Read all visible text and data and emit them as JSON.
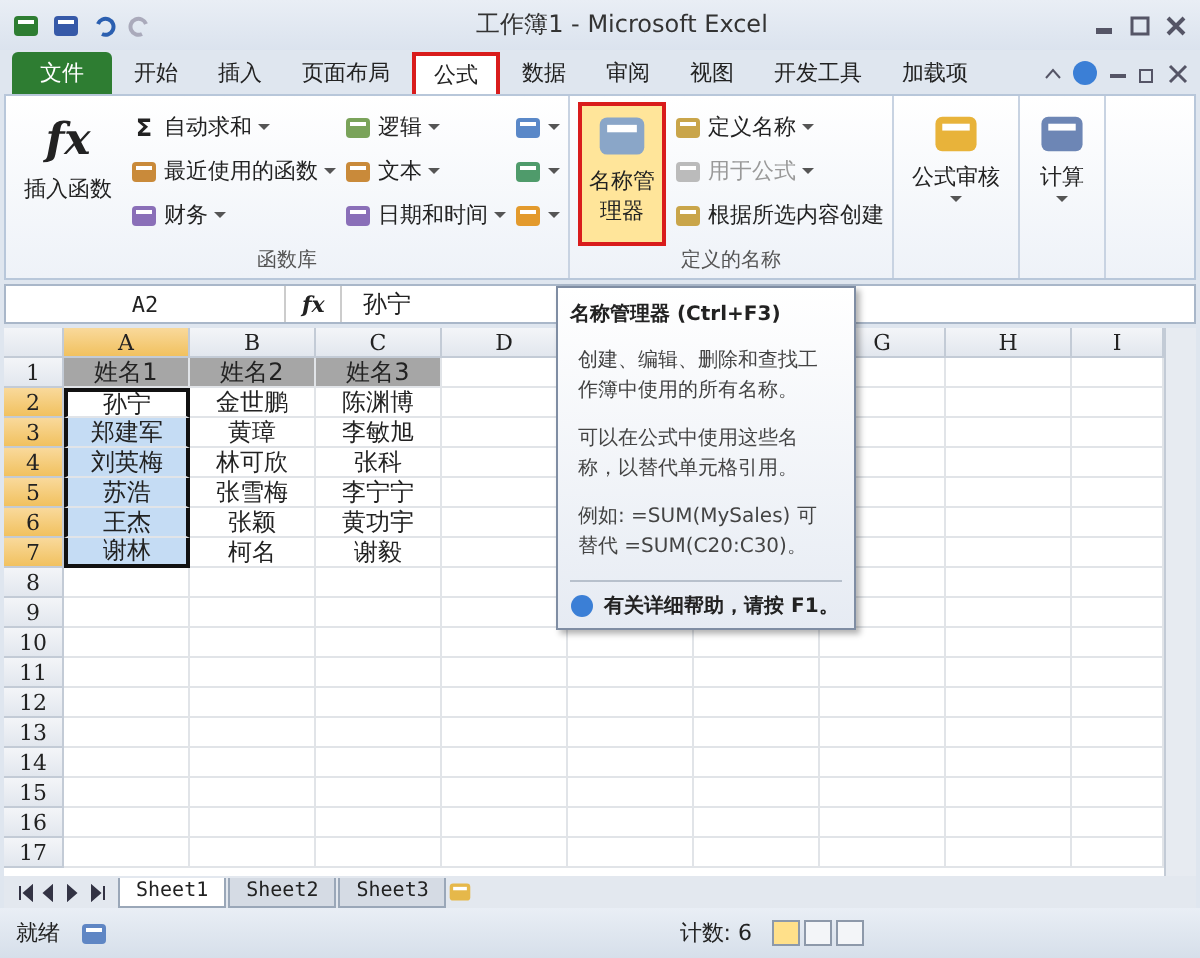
{
  "window": {
    "title": "工作簿1 - Microsoft Excel"
  },
  "tabs": [
    {
      "label": "文件",
      "kind": "file",
      "selected": false
    },
    {
      "label": "开始",
      "kind": "tab",
      "selected": false
    },
    {
      "label": "插入",
      "kind": "tab",
      "selected": false
    },
    {
      "label": "页面布局",
      "kind": "tab",
      "selected": false
    },
    {
      "label": "公式",
      "kind": "tab",
      "selected": true
    },
    {
      "label": "数据",
      "kind": "tab",
      "selected": false
    },
    {
      "label": "审阅",
      "kind": "tab",
      "selected": false
    },
    {
      "label": "视图",
      "kind": "tab",
      "selected": false
    },
    {
      "label": "开发工具",
      "kind": "tab",
      "selected": false
    },
    {
      "label": "加载项",
      "kind": "tab",
      "selected": false
    }
  ],
  "ribbon": {
    "function_library": {
      "label": "函数库",
      "insert_function": {
        "symbol": "fx",
        "label": "插入函数"
      },
      "columns": [
        [
          {
            "label": "自动求和",
            "symbol": "Σ"
          },
          {
            "label": "最近使用的函数"
          },
          {
            "label": "财务"
          }
        ],
        [
          {
            "label": "逻辑"
          },
          {
            "label": "文本"
          },
          {
            "label": "日期和时间"
          }
        ]
      ]
    },
    "defined_names": {
      "label": "定义的名称",
      "name_manager": {
        "label": "名称管理器",
        "highlighted": true
      },
      "items": [
        {
          "label": "定义名称",
          "dropdown": true,
          "disabled": false
        },
        {
          "label": "用于公式",
          "dropdown": true,
          "disabled": true
        },
        {
          "label": "根据所选内容创建",
          "dropdown": false,
          "disabled": false
        }
      ]
    },
    "extra": [
      {
        "label": "公式审核"
      },
      {
        "label": "计算"
      }
    ]
  },
  "formula_bar": {
    "name_box": "A2",
    "fx_label": "fx",
    "value": "孙宁"
  },
  "columns": [
    {
      "label": "A",
      "selected": true
    },
    {
      "label": "B",
      "selected": false
    },
    {
      "label": "C",
      "selected": false
    },
    {
      "label": "D",
      "selected": false
    },
    {
      "label": "G",
      "selected": false
    },
    {
      "label": "H",
      "selected": false
    },
    {
      "label": "I",
      "selected": false
    }
  ],
  "rows": [
    {
      "number": "1",
      "selected": false,
      "cells": [
        {
          "text": "姓名1",
          "kind": "header"
        },
        {
          "text": "姓名2",
          "kind": "header"
        },
        {
          "text": "姓名3",
          "kind": "header"
        }
      ]
    },
    {
      "number": "2",
      "selected": true,
      "cells": [
        {
          "text": "孙宁",
          "kind": "active"
        },
        {
          "text": "金世鹏",
          "kind": "plain"
        },
        {
          "text": "陈渊博",
          "kind": "plain"
        }
      ]
    },
    {
      "number": "3",
      "selected": true,
      "cells": [
        {
          "text": "郑建军",
          "kind": "selected"
        },
        {
          "text": "黄璋",
          "kind": "plain"
        },
        {
          "text": "李敏旭",
          "kind": "plain"
        }
      ]
    },
    {
      "number": "4",
      "selected": true,
      "cells": [
        {
          "text": "刘英梅",
          "kind": "selected"
        },
        {
          "text": "林可欣",
          "kind": "plain"
        },
        {
          "text": "张科",
          "kind": "plain"
        }
      ]
    },
    {
      "number": "5",
      "selected": true,
      "cells": [
        {
          "text": "苏浩",
          "kind": "selected"
        },
        {
          "text": "张雪梅",
          "kind": "plain"
        },
        {
          "text": "李宁宁",
          "kind": "plain"
        }
      ]
    },
    {
      "number": "6",
      "selected": true,
      "cells": [
        {
          "text": "王杰",
          "kind": "selected"
        },
        {
          "text": "张颖",
          "kind": "plain"
        },
        {
          "text": "黄功宇",
          "kind": "plain"
        }
      ]
    },
    {
      "number": "7",
      "selected": true,
      "cells": [
        {
          "text": "谢林",
          "kind": "selected"
        },
        {
          "text": "柯名",
          "kind": "plain"
        },
        {
          "text": "谢毅",
          "kind": "plain"
        }
      ]
    },
    {
      "number": "8",
      "selected": false,
      "cells": []
    },
    {
      "number": "9",
      "selected": false,
      "cells": []
    },
    {
      "number": "10",
      "selected": false,
      "cells": []
    },
    {
      "number": "11",
      "selected": false,
      "cells": []
    },
    {
      "number": "12",
      "selected": false,
      "cells": []
    },
    {
      "number": "13",
      "selected": false,
      "cells": []
    },
    {
      "number": "14",
      "selected": false,
      "cells": []
    },
    {
      "number": "15",
      "selected": false,
      "cells": []
    },
    {
      "number": "16",
      "selected": false,
      "cells": []
    },
    {
      "number": "17",
      "selected": false,
      "cells": []
    }
  ],
  "tooltip": {
    "title": "名称管理器 (Ctrl+F3)",
    "paragraphs": [
      "创建、编辑、删除和查找工作簿中使用的所有名称。",
      "可以在公式中使用这些名称，以替代单元格引用。",
      "例如: =SUM(MySales) 可替代 =SUM(C20:C30)。"
    ],
    "help": "有关详细帮助，请按 F1。"
  },
  "sheets": [
    {
      "label": "Sheet1",
      "selected": true
    },
    {
      "label": "Sheet2",
      "selected": false
    },
    {
      "label": "Sheet3",
      "selected": false
    }
  ],
  "status_bar": {
    "ready": "就绪",
    "count": "计数: 6",
    "views": [
      {
        "selected": true
      },
      {
        "selected": false
      },
      {
        "selected": false
      }
    ]
  }
}
